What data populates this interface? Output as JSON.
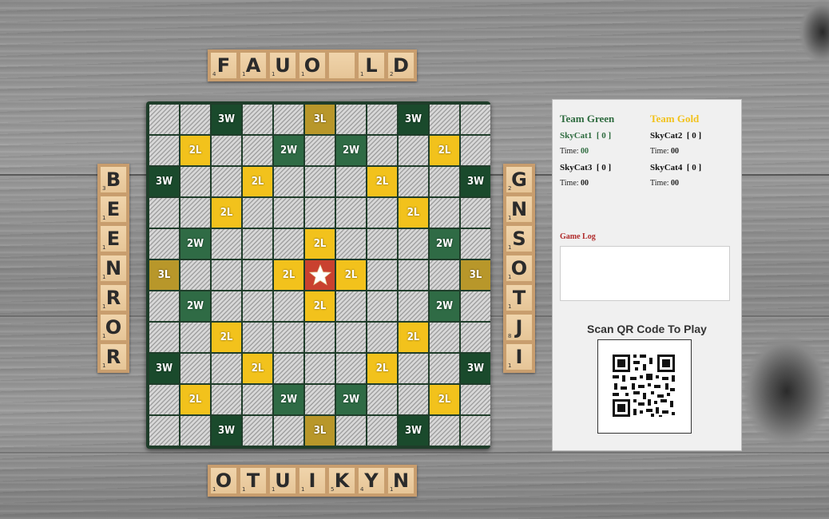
{
  "top_rack": [
    {
      "letter": "F",
      "pts": "4"
    },
    {
      "letter": "A",
      "pts": "1"
    },
    {
      "letter": "U",
      "pts": "1"
    },
    {
      "letter": "O",
      "pts": "1"
    },
    {
      "letter": "",
      "pts": ""
    },
    {
      "letter": "L",
      "pts": "1"
    },
    {
      "letter": "D",
      "pts": "2"
    }
  ],
  "left_rack": [
    {
      "letter": "B",
      "pts": "3"
    },
    {
      "letter": "E",
      "pts": "1"
    },
    {
      "letter": "E",
      "pts": "1"
    },
    {
      "letter": "N",
      "pts": "1"
    },
    {
      "letter": "R",
      "pts": "1"
    },
    {
      "letter": "O",
      "pts": "1"
    },
    {
      "letter": "R",
      "pts": "1"
    }
  ],
  "right_rack": [
    {
      "letter": "G",
      "pts": "2"
    },
    {
      "letter": "N",
      "pts": "1"
    },
    {
      "letter": "S",
      "pts": "1"
    },
    {
      "letter": "O",
      "pts": "1"
    },
    {
      "letter": "T",
      "pts": "1"
    },
    {
      "letter": "J",
      "pts": "8"
    },
    {
      "letter": "I",
      "pts": "1"
    }
  ],
  "bottom_rack": [
    {
      "letter": "O",
      "pts": "1"
    },
    {
      "letter": "T",
      "pts": "1"
    },
    {
      "letter": "U",
      "pts": "1"
    },
    {
      "letter": "I",
      "pts": "1"
    },
    {
      "letter": "K",
      "pts": "5"
    },
    {
      "letter": "Y",
      "pts": "4"
    },
    {
      "letter": "N",
      "pts": "1"
    }
  ],
  "board": {
    "rows": [
      [
        "n",
        "n",
        "tw",
        "n",
        "n",
        "tl",
        "n",
        "n",
        "tw",
        "n",
        "n"
      ],
      [
        "n",
        "dl",
        "n",
        "n",
        "dw",
        "n",
        "dw",
        "n",
        "n",
        "dl",
        "n"
      ],
      [
        "tw",
        "n",
        "n",
        "dl",
        "n",
        "n",
        "n",
        "dl",
        "n",
        "n",
        "tw"
      ],
      [
        "n",
        "n",
        "dl",
        "n",
        "n",
        "n",
        "n",
        "n",
        "dl",
        "n",
        "n"
      ],
      [
        "n",
        "dw",
        "n",
        "n",
        "n",
        "dl",
        "n",
        "n",
        "n",
        "dw",
        "n"
      ],
      [
        "tl",
        "n",
        "n",
        "n",
        "dl",
        "st",
        "dl",
        "n",
        "n",
        "n",
        "tl"
      ],
      [
        "n",
        "dw",
        "n",
        "n",
        "n",
        "dl",
        "n",
        "n",
        "n",
        "dw",
        "n"
      ],
      [
        "n",
        "n",
        "dl",
        "n",
        "n",
        "n",
        "n",
        "n",
        "dl",
        "n",
        "n"
      ],
      [
        "tw",
        "n",
        "n",
        "dl",
        "n",
        "n",
        "n",
        "dl",
        "n",
        "n",
        "tw"
      ],
      [
        "n",
        "dl",
        "n",
        "n",
        "dw",
        "n",
        "dw",
        "n",
        "n",
        "dl",
        "n"
      ],
      [
        "n",
        "n",
        "tw",
        "n",
        "n",
        "tl",
        "n",
        "n",
        "tw",
        "n",
        "n"
      ]
    ],
    "labels": {
      "tw": "3W",
      "dw": "2W",
      "tl": "3L",
      "dl": "2L",
      "st": "",
      "n": ""
    },
    "colors": {
      "tw": "#1a4a2c",
      "dw": "#2f6b45",
      "tl": "#b8972a",
      "dl": "#f2c21c",
      "st": "#c9412f"
    }
  },
  "panel": {
    "team_green": {
      "name": "Team Green",
      "color": "#2e6b3f"
    },
    "team_gold": {
      "name": "Team Gold",
      "color": "#f2c21c"
    },
    "players": [
      {
        "name": "SkyCat1",
        "score": "[ 0 ]",
        "time_label": "Time:",
        "time": "00"
      },
      {
        "name": "SkyCat2",
        "score": "[ 0 ]",
        "time_label": "Time:",
        "time": "00"
      },
      {
        "name": "SkyCat3",
        "score": "[ 0 ]",
        "time_label": "Time:",
        "time": "00"
      },
      {
        "name": "SkyCat4",
        "score": "[ 0 ]",
        "time_label": "Time:",
        "time": "00"
      }
    ],
    "game_log_title": "Game Log",
    "qr_title": "Scan QR Code To Play"
  }
}
